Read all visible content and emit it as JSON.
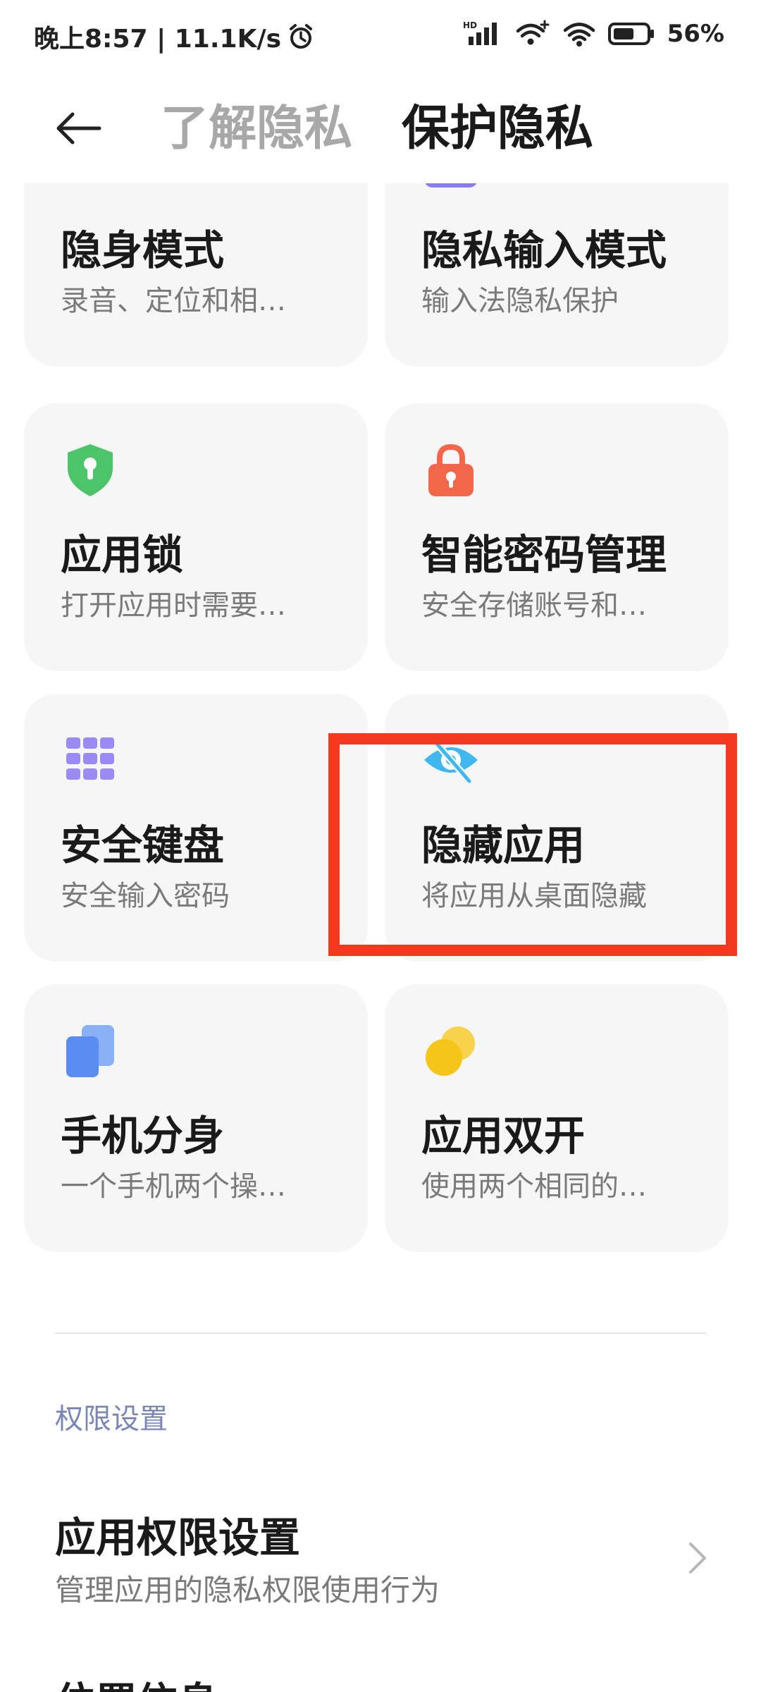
{
  "status_bar": {
    "time_speed": "晚上8:57 | 11.1K/s",
    "battery": "56%",
    "icons": [
      "alarm-icon",
      "hd-signal-icon",
      "wifi-hotspot-icon",
      "wifi-icon",
      "battery-icon"
    ]
  },
  "header": {
    "back_icon": "back-arrow-icon",
    "tabs": [
      {
        "label": "了解隐私",
        "active": false
      },
      {
        "label": "保护隐私",
        "active": true
      }
    ]
  },
  "cards": [
    {
      "title": "隐身模式",
      "subtitle": "录音、定位和相…",
      "icon": "incognito-icon",
      "color": "#5b8df0"
    },
    {
      "title": "隐私输入模式",
      "subtitle": "输入法隐私保护",
      "icon": "keyboard-privacy-icon",
      "color": "#8a7cf0"
    },
    {
      "title": "应用锁",
      "subtitle": "打开应用时需要…",
      "icon": "shield-lock-icon",
      "color": "#4cc46a"
    },
    {
      "title": "智能密码管理",
      "subtitle": "安全存储账号和…",
      "icon": "padlock-icon",
      "color": "#f2674a"
    },
    {
      "title": "安全键盘",
      "subtitle": "安全输入密码",
      "icon": "keypad-icon",
      "color": "#9a8af2"
    },
    {
      "title": "隐藏应用",
      "subtitle": "将应用从桌面隐藏",
      "icon": "eye-off-icon",
      "color": "#3fb8f0"
    },
    {
      "title": "手机分身",
      "subtitle": "一个手机两个操…",
      "icon": "second-space-icon",
      "color": "#5b8df0"
    },
    {
      "title": "应用双开",
      "subtitle": "使用两个相同的…",
      "icon": "dual-apps-icon",
      "color": "#f5c518"
    }
  ],
  "section": {
    "label": "权限设置"
  },
  "settings": [
    {
      "title": "应用权限设置",
      "subtitle": "管理应用的隐私权限使用行为",
      "icon": "chevron-right-icon"
    }
  ],
  "next_row": {
    "title": "位置信息"
  },
  "highlight": {
    "color": "#f3391f",
    "target": "隐藏应用"
  }
}
